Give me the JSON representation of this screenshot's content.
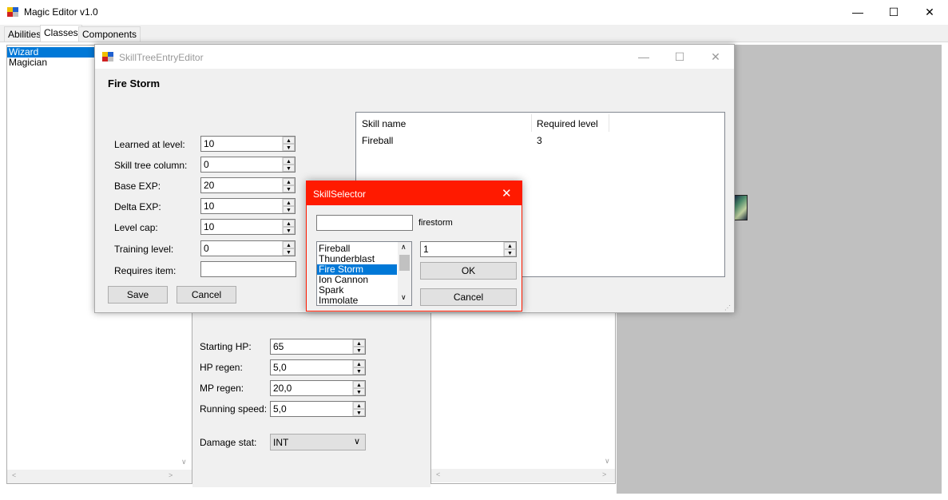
{
  "main_window": {
    "title": "Magic Editor v1.0",
    "tabs": [
      "Abilities",
      "Classes",
      "Components"
    ],
    "active_tab": "Classes",
    "classes": [
      "Wizard",
      "Magician"
    ],
    "selected_class": "Wizard",
    "stats": [
      {
        "label": "Starting HP:",
        "value": "65"
      },
      {
        "label": "HP regen:",
        "value": "5,0"
      },
      {
        "label": "MP regen:",
        "value": "20,0"
      },
      {
        "label": "Running speed:",
        "value": "5,0"
      }
    ],
    "damage_stat_label": "Damage stat:",
    "damage_stat_value": "INT"
  },
  "skill_editor": {
    "title": "SkillTreeEntryEditor",
    "heading": "Fire Storm",
    "fields": [
      {
        "label": "Learned at level:",
        "value": "10"
      },
      {
        "label": "Skill tree column:",
        "value": "0"
      },
      {
        "label": "Base EXP:",
        "value": "20"
      },
      {
        "label": "Delta EXP:",
        "value": "10"
      },
      {
        "label": "Level cap:",
        "value": "10"
      },
      {
        "label": "Training level:",
        "value": "0"
      }
    ],
    "requires_item_label": "Requires item:",
    "requires_item_value": "",
    "save_label": "Save",
    "cancel_label": "Cancel",
    "prereq_headers": [
      "Skill name",
      "Required level"
    ],
    "prereq_rows": [
      {
        "name": "Fireball",
        "level": "3"
      }
    ]
  },
  "skill_selector": {
    "title": "SkillSelector",
    "search_value": "",
    "search_hint": "firestorm",
    "skills": [
      "Fireball",
      "Thunderblast",
      "Fire Storm",
      "Ion Cannon",
      "Spark",
      "Immolate"
    ],
    "selected_skill": "Fire Storm",
    "level_value": "1",
    "ok_label": "OK",
    "cancel_label": "Cancel",
    "accent_color": "#ff1a00"
  }
}
